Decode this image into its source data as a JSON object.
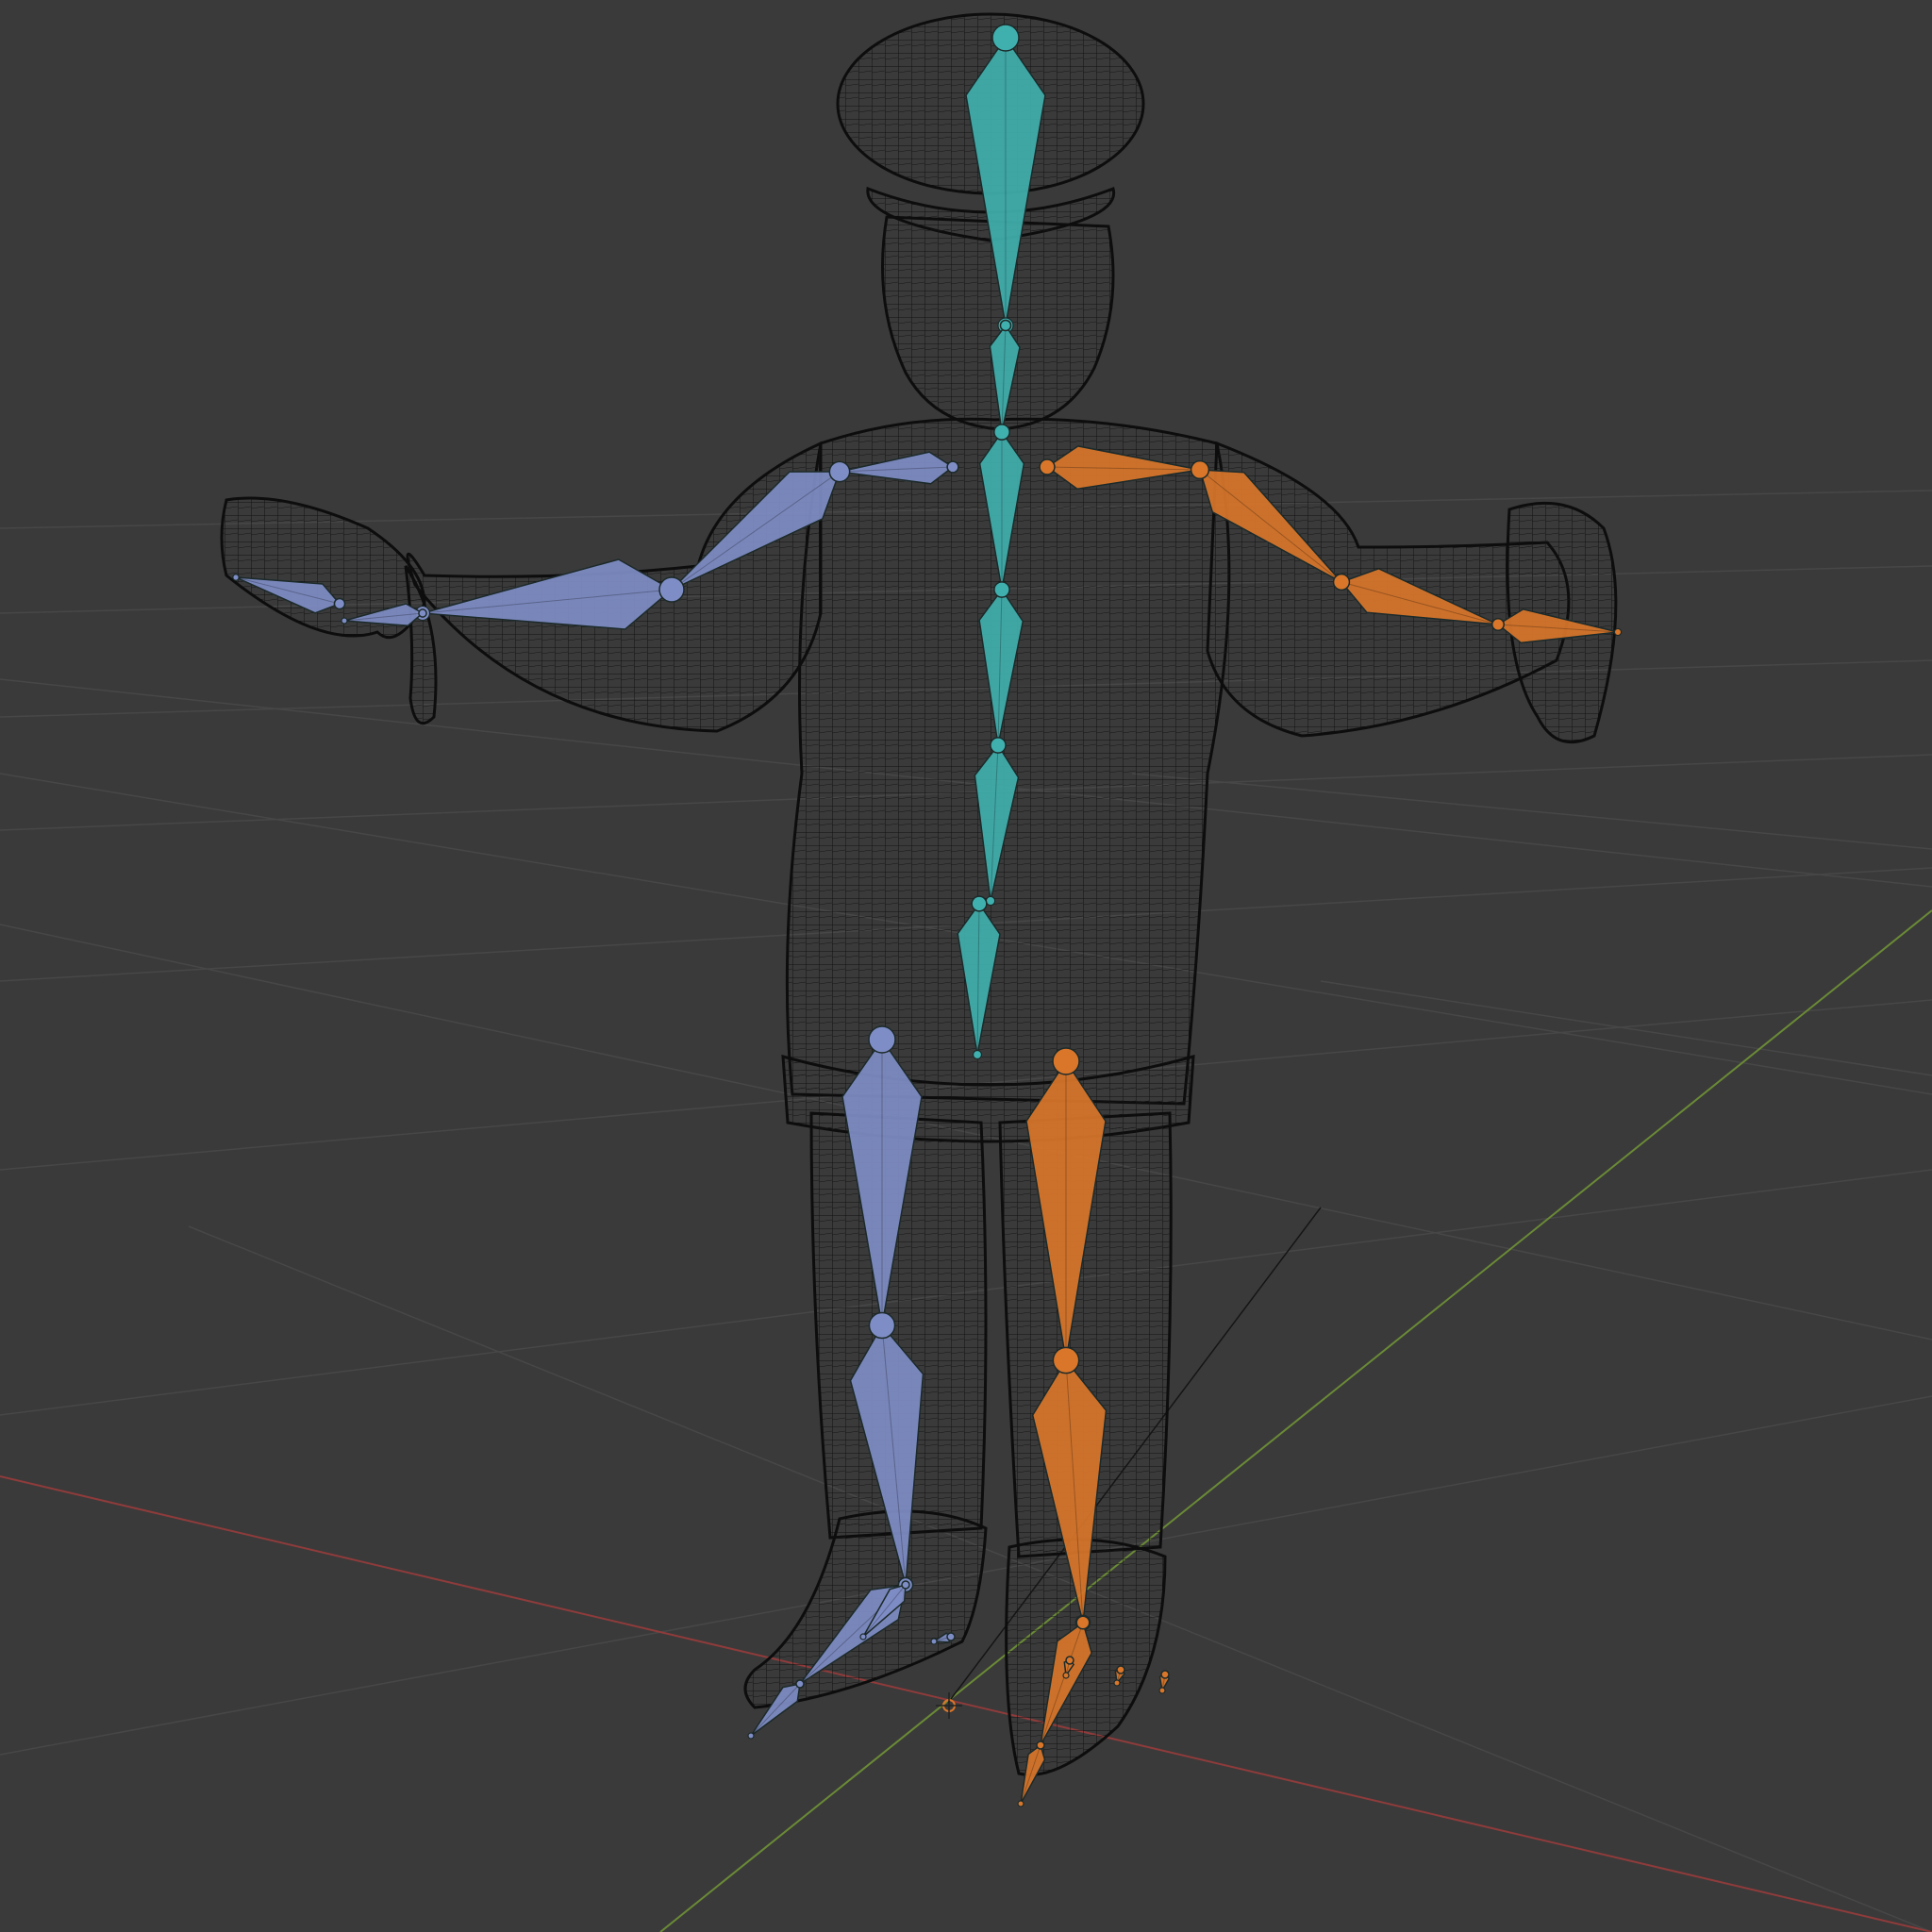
{
  "viewport": {
    "view": "3D viewport",
    "shading": "wireframe",
    "background_color": "#3a3a3a"
  },
  "colors": {
    "grid": "#4a4a4a",
    "axis_x": "#9a3f3f",
    "axis_y": "#6f8f3a",
    "wireframe": "#111111",
    "bones_center": "#40b0ae",
    "bones_left": "#7f8dc6",
    "bones_right": "#d9762a"
  },
  "armature": {
    "groups": [
      {
        "id": "center",
        "color_key": "bones_center"
      },
      {
        "id": "left",
        "color_key": "bones_left"
      },
      {
        "id": "right",
        "color_key": "bones_right"
      }
    ]
  },
  "scene_objects": [
    "character-mesh",
    "armature",
    "origin-marker"
  ]
}
